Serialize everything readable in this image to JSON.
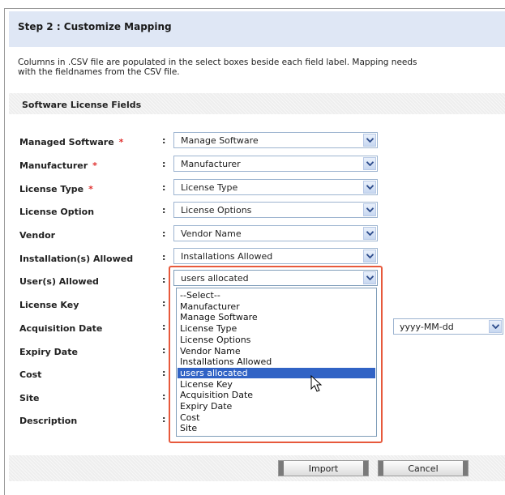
{
  "step_title": "Step 2 : Customize Mapping",
  "description": "Columns in .CSV file are populated in the select boxes beside each field label. Mapping needs\nwith the fieldnames from the CSV file.",
  "section_title": "Software License Fields",
  "colon": ":",
  "required_mark": "*",
  "fields": [
    {
      "label": "Managed Software",
      "required": true,
      "value": "Manage Software"
    },
    {
      "label": "Manufacturer",
      "required": true,
      "value": "Manufacturer"
    },
    {
      "label": "License Type",
      "required": true,
      "value": "License Type"
    },
    {
      "label": "License Option",
      "required": false,
      "value": "License Options"
    },
    {
      "label": "Vendor",
      "required": false,
      "value": "Vendor Name"
    },
    {
      "label": "Installation(s) Allowed",
      "required": false,
      "value": "Installations Allowed"
    },
    {
      "label": "User(s) Allowed",
      "required": false,
      "value": "users allocated"
    },
    {
      "label": "License Key",
      "required": false,
      "value": ""
    },
    {
      "label": "Acquisition Date",
      "required": false,
      "value": ""
    },
    {
      "label": "Expiry Date",
      "required": false,
      "value": ""
    },
    {
      "label": "Cost",
      "required": false,
      "value": ""
    },
    {
      "label": "Site",
      "required": false,
      "value": ""
    },
    {
      "label": "Description",
      "required": false,
      "value": ""
    }
  ],
  "dropdown_options": [
    "--Select--",
    "Manufacturer",
    "Manage Software",
    "License Type",
    "License Options",
    "Vendor Name",
    "Installations Allowed",
    "users allocated",
    "License Key",
    "Acquisition Date",
    "Expiry Date",
    "Cost",
    "Site"
  ],
  "dropdown_selected": "users allocated",
  "date_format": "yyyy-MM-dd",
  "buttons": {
    "import": "Import",
    "cancel": "Cancel"
  },
  "colors": {
    "header_bg": "#dfe7f5",
    "required": "#e0312f",
    "highlight": "#3163c5",
    "focus_border": "#e7593c"
  }
}
